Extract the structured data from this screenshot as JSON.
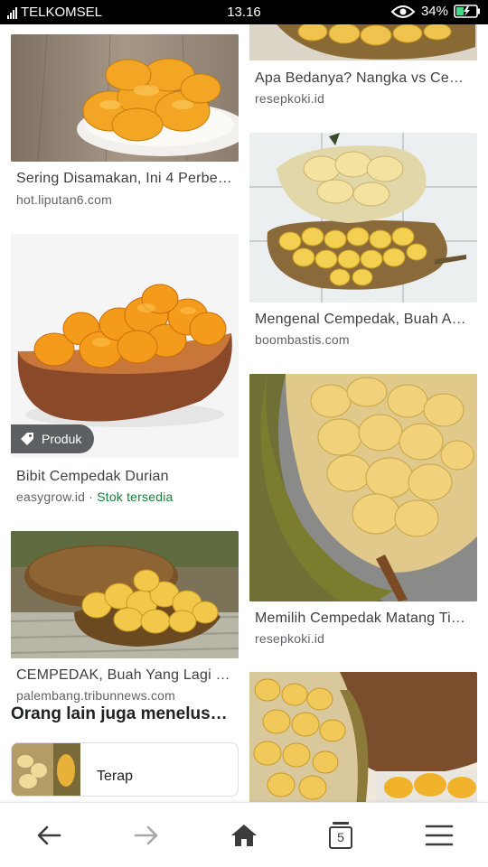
{
  "status_bar": {
    "carrier": "TELKOMSEL",
    "time": "13.16",
    "battery": "34%"
  },
  "results": [
    {
      "title": "Sering Disamakan, Ini 4 Perbe…",
      "source": "hot.liputan6.com"
    },
    {
      "title": "Bibit Cempedak Durian",
      "source": "easygrow.id",
      "separator": " · ",
      "stock": "Stok tersedia",
      "badge": "Produk"
    },
    {
      "title": "CEMPEDAK, Buah Yang Lagi …",
      "source": "palembang.tribunnews.com"
    },
    {
      "title": "Apa Bedanya? Nangka vs Ce…",
      "source": "resepkoki.id"
    },
    {
      "title": "Mengenal Cempedak, Buah A…",
      "source": "boombastis.com"
    },
    {
      "title": "Memilih Cempedak Matang Ti…",
      "source": "resepkoki.id"
    }
  ],
  "related": {
    "heading": "Orang lain juga menelus…",
    "first_item": "Terap"
  },
  "nav": {
    "tab_count": "5"
  },
  "colors": {
    "stock_green": "#188038",
    "text_primary": "#3c4043",
    "text_secondary": "#5f6368"
  }
}
